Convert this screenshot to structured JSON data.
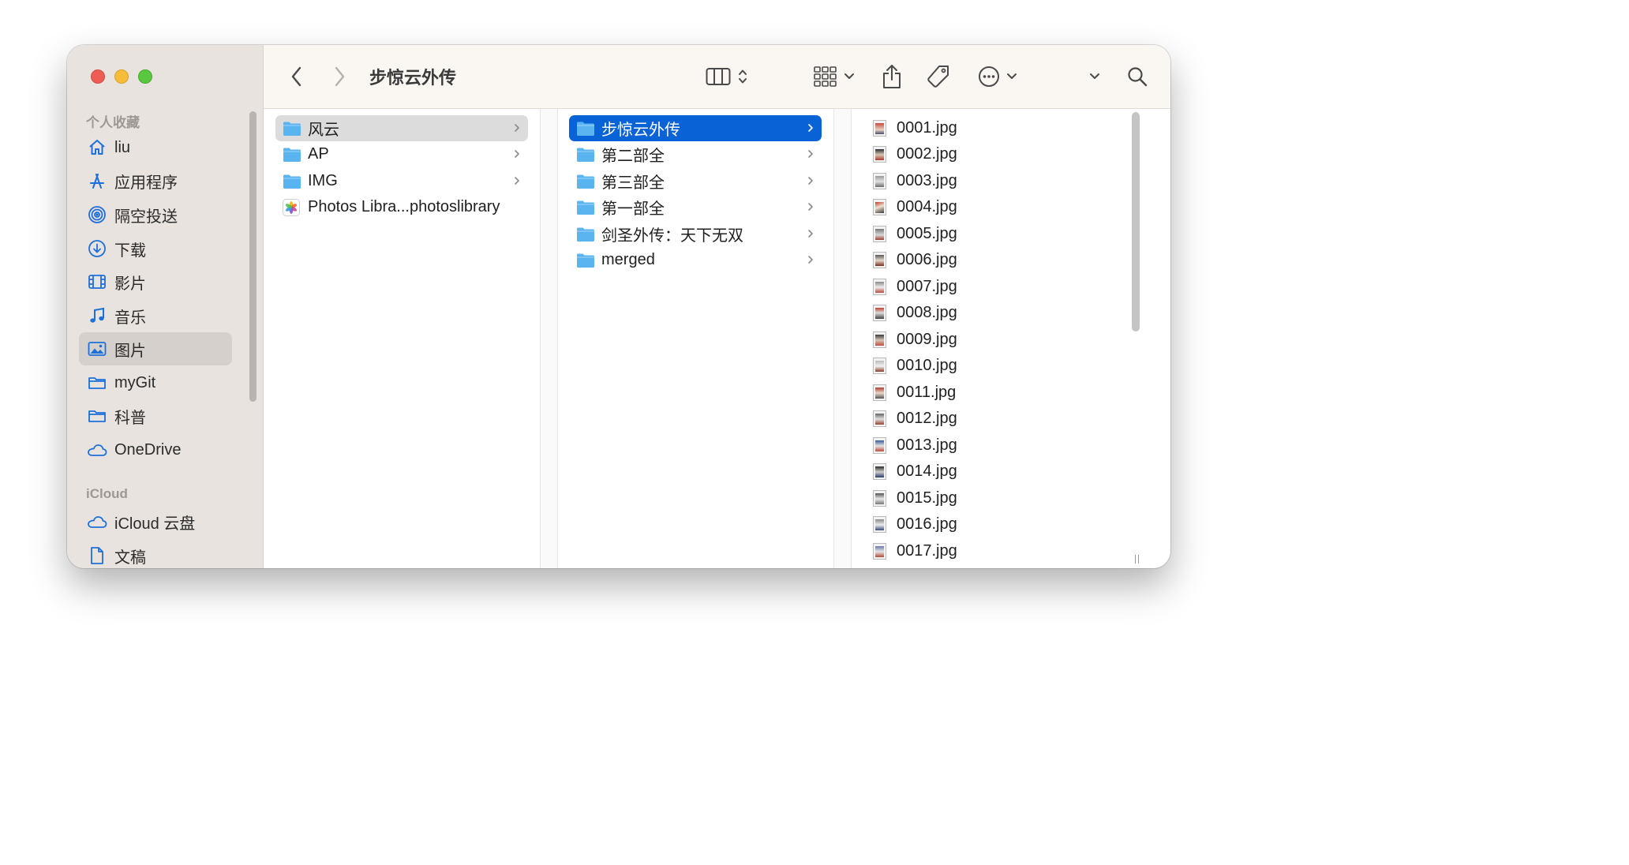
{
  "window": {
    "title": "步惊云外传"
  },
  "sidebar": {
    "favorites_heading": "个人收藏",
    "icloud_heading": "iCloud",
    "items": [
      {
        "label": "liu",
        "icon": "house-icon"
      },
      {
        "label": "应用程序",
        "icon": "applications-icon"
      },
      {
        "label": "隔空投送",
        "icon": "airdrop-icon"
      },
      {
        "label": "下载",
        "icon": "download-icon"
      },
      {
        "label": "影片",
        "icon": "film-icon"
      },
      {
        "label": "音乐",
        "icon": "music-note-icon"
      },
      {
        "label": "图片",
        "icon": "photo-icon",
        "selected": true
      },
      {
        "label": "myGit",
        "icon": "folder-outline-icon"
      },
      {
        "label": "科普",
        "icon": "folder-outline-icon"
      },
      {
        "label": "OneDrive",
        "icon": "cloud-icon"
      }
    ],
    "icloud_items": [
      {
        "label": "iCloud 云盘",
        "icon": "icloud-icon"
      },
      {
        "label": "文稿",
        "icon": "document-icon"
      }
    ]
  },
  "columns": {
    "col1": [
      {
        "label": "风云",
        "type": "folder",
        "selected": true
      },
      {
        "label": "AP",
        "type": "folder"
      },
      {
        "label": "IMG",
        "type": "folder"
      },
      {
        "label": "Photos Libra...photoslibrary",
        "type": "photos-library"
      }
    ],
    "col2": [
      {
        "label": "步惊云外传",
        "type": "folder",
        "selected": true
      },
      {
        "label": "第二部全",
        "type": "folder"
      },
      {
        "label": "第三部全",
        "type": "folder"
      },
      {
        "label": "第一部全",
        "type": "folder"
      },
      {
        "label": "剑圣外传：天下无双",
        "type": "folder"
      },
      {
        "label": "merged",
        "type": "folder"
      }
    ],
    "col3": [
      "0001.jpg",
      "0002.jpg",
      "0003.jpg",
      "0004.jpg",
      "0005.jpg",
      "0006.jpg",
      "0007.jpg",
      "0008.jpg",
      "0009.jpg",
      "0010.jpg",
      "0011.jpg",
      "0012.jpg",
      "0013.jpg",
      "0014.jpg",
      "0015.jpg",
      "0016.jpg",
      "0017.jpg"
    ]
  },
  "colors": {
    "accent": "#0a63d6",
    "folder": "#5ab4f0",
    "sidebar_icon": "#1e6fd9"
  }
}
